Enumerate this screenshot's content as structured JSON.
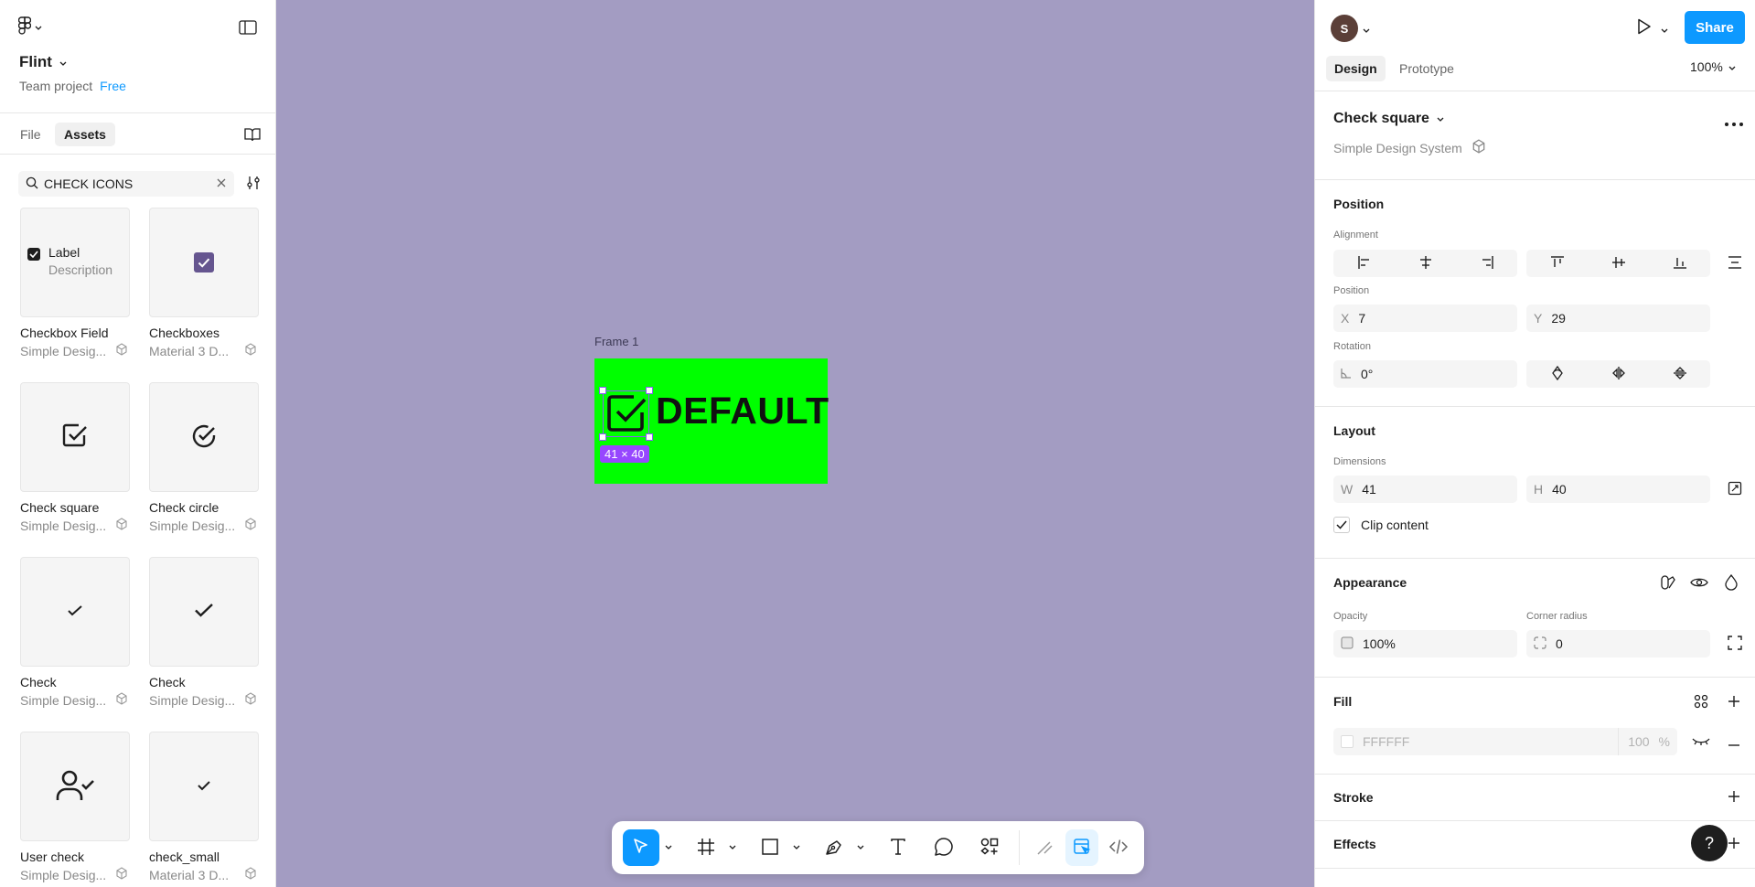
{
  "file": {
    "name": "Flint",
    "project": "Team project",
    "plan": "Free"
  },
  "left_tabs": [
    {
      "label": "File"
    },
    {
      "label": "Assets"
    }
  ],
  "search": {
    "value": "CHECK ICONS"
  },
  "assets": [
    {
      "name": "Checkbox Field",
      "library": "Simple Desig...",
      "preview_label": "Label",
      "preview_desc": "Description"
    },
    {
      "name": "Checkboxes",
      "library": "Material 3 D..."
    },
    {
      "name": "Check square",
      "library": "Simple Desig..."
    },
    {
      "name": "Check circle",
      "library": "Simple Desig..."
    },
    {
      "name": "Check",
      "library": "Simple Desig..."
    },
    {
      "name": "Check",
      "library": "Simple Desig..."
    },
    {
      "name": "User check",
      "library": "Simple Desig..."
    },
    {
      "name": "check_small",
      "library": "Material 3 D..."
    }
  ],
  "canvas": {
    "frame_label": "Frame 1",
    "frame_text": "DEFAULT",
    "selection_size": "41 × 40",
    "background_color": "#a39cc2",
    "frame_color": "#00ff00"
  },
  "header": {
    "avatar_initial": "S",
    "share_label": "Share",
    "zoom": "100%"
  },
  "right_tabs": [
    {
      "label": "Design"
    },
    {
      "label": "Prototype"
    }
  ],
  "component": {
    "name": "Check square",
    "library": "Simple Design System"
  },
  "position": {
    "title": "Position",
    "alignment_label": "Alignment",
    "position_label": "Position",
    "x_prefix": "X",
    "x": "7",
    "y_prefix": "Y",
    "y": "29",
    "rotation_label": "Rotation",
    "rotation": "0°"
  },
  "layout": {
    "title": "Layout",
    "dimensions_label": "Dimensions",
    "w_prefix": "W",
    "w": "41",
    "h_prefix": "H",
    "h": "40",
    "clip_content_label": "Clip content"
  },
  "appearance": {
    "title": "Appearance",
    "opacity_label": "Opacity",
    "opacity": "100%",
    "radius_label": "Corner radius",
    "radius": "0"
  },
  "fill": {
    "title": "Fill",
    "hex": "FFFFFF",
    "opacity": "100",
    "unit": "%"
  },
  "stroke": {
    "title": "Stroke"
  },
  "effects": {
    "title": "Effects"
  },
  "help_label": "?",
  "colors": {
    "accent": "#0d99ff",
    "selection": "#9747ff"
  }
}
